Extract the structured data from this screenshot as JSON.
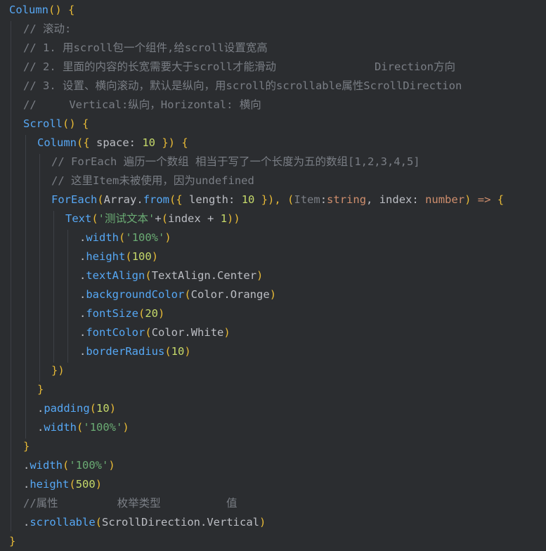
{
  "lines": [
    [
      {
        "t": "Column",
        "c": "fn"
      },
      {
        "t": "() ",
        "c": "brc"
      },
      {
        "t": "{",
        "c": "brc"
      }
    ],
    [
      {
        "t": "// 滚动:",
        "c": "cmt"
      }
    ],
    [
      {
        "t": "// 1. 用scroll包一个组件,给scroll设置宽高",
        "c": "cmt"
      }
    ],
    [
      {
        "t": "// 2. 里面的内容的长宽需要大于scroll才能滑动               Direction方向",
        "c": "cmt"
      }
    ],
    [
      {
        "t": "// 3. 设置、横向滚动，默认是纵向，用scroll的scrollable属性ScrollDirection",
        "c": "cmt"
      }
    ],
    [
      {
        "t": "//     Vertical:纵向，Horizontal: 横向",
        "c": "cmt"
      }
    ],
    [
      {
        "t": "Scroll",
        "c": "fn"
      },
      {
        "t": "() ",
        "c": "brc"
      },
      {
        "t": "{",
        "c": "brc"
      }
    ],
    [
      {
        "t": "Column",
        "c": "fn"
      },
      {
        "t": "({ ",
        "c": "brc"
      },
      {
        "t": "space",
        "c": "txt"
      },
      {
        "t": ": ",
        "c": "txt"
      },
      {
        "t": "10",
        "c": "numy"
      },
      {
        "t": " }) {",
        "c": "brc"
      }
    ],
    [
      {
        "t": "// ForEach 遍历一个数组 相当于写了一个长度为五的数组[1,2,3,4,5]",
        "c": "cmt"
      }
    ],
    [
      {
        "t": "// 这里Item未被使用，因为undefined",
        "c": "cmt"
      }
    ],
    [
      {
        "t": "ForEach",
        "c": "fn"
      },
      {
        "t": "(",
        "c": "brc"
      },
      {
        "t": "Array",
        "c": "txt"
      },
      {
        "t": ".",
        "c": "txt"
      },
      {
        "t": "from",
        "c": "mth"
      },
      {
        "t": "({ ",
        "c": "brc"
      },
      {
        "t": "length",
        "c": "txt"
      },
      {
        "t": ": ",
        "c": "txt"
      },
      {
        "t": "10",
        "c": "numy"
      },
      {
        "t": " }), ",
        "c": "brc"
      },
      {
        "t": "(",
        "c": "brc"
      },
      {
        "t": "Item",
        "c": "prm"
      },
      {
        "t": ":",
        "c": "txt"
      },
      {
        "t": "string",
        "c": "kw"
      },
      {
        "t": ", ",
        "c": "txt"
      },
      {
        "t": "index",
        "c": "txt"
      },
      {
        "t": ": ",
        "c": "txt"
      },
      {
        "t": "number",
        "c": "kw"
      },
      {
        "t": ") ",
        "c": "brc"
      },
      {
        "t": "=> ",
        "c": "kw"
      },
      {
        "t": "{",
        "c": "brc"
      }
    ],
    [
      {
        "t": "Text",
        "c": "fn"
      },
      {
        "t": "(",
        "c": "brc"
      },
      {
        "t": "'测试文本'",
        "c": "str"
      },
      {
        "t": "+",
        "c": "txt"
      },
      {
        "t": "(",
        "c": "brc"
      },
      {
        "t": "index",
        "c": "txt"
      },
      {
        "t": " + ",
        "c": "txt"
      },
      {
        "t": "1",
        "c": "numy"
      },
      {
        "t": "))",
        "c": "brc"
      }
    ],
    [
      {
        "t": ".",
        "c": "txt"
      },
      {
        "t": "width",
        "c": "mth"
      },
      {
        "t": "(",
        "c": "brc"
      },
      {
        "t": "'100%'",
        "c": "str"
      },
      {
        "t": ")",
        "c": "brc"
      }
    ],
    [
      {
        "t": ".",
        "c": "txt"
      },
      {
        "t": "height",
        "c": "mth"
      },
      {
        "t": "(",
        "c": "brc"
      },
      {
        "t": "100",
        "c": "numy"
      },
      {
        "t": ")",
        "c": "brc"
      }
    ],
    [
      {
        "t": ".",
        "c": "txt"
      },
      {
        "t": "textAlign",
        "c": "mth"
      },
      {
        "t": "(",
        "c": "brc"
      },
      {
        "t": "TextAlign",
        "c": "txt"
      },
      {
        "t": ".",
        "c": "txt"
      },
      {
        "t": "Center",
        "c": "txt"
      },
      {
        "t": ")",
        "c": "brc"
      }
    ],
    [
      {
        "t": ".",
        "c": "txt"
      },
      {
        "t": "backgroundColor",
        "c": "mth"
      },
      {
        "t": "(",
        "c": "brc"
      },
      {
        "t": "Color",
        "c": "txt"
      },
      {
        "t": ".",
        "c": "txt"
      },
      {
        "t": "Orange",
        "c": "txt"
      },
      {
        "t": ")",
        "c": "brc"
      }
    ],
    [
      {
        "t": ".",
        "c": "txt"
      },
      {
        "t": "fontSize",
        "c": "mth"
      },
      {
        "t": "(",
        "c": "brc"
      },
      {
        "t": "20",
        "c": "numy"
      },
      {
        "t": ")",
        "c": "brc"
      }
    ],
    [
      {
        "t": ".",
        "c": "txt"
      },
      {
        "t": "fontColor",
        "c": "mth"
      },
      {
        "t": "(",
        "c": "brc"
      },
      {
        "t": "Color",
        "c": "txt"
      },
      {
        "t": ".",
        "c": "txt"
      },
      {
        "t": "White",
        "c": "txt"
      },
      {
        "t": ")",
        "c": "brc"
      }
    ],
    [
      {
        "t": ".",
        "c": "txt"
      },
      {
        "t": "borderRadius",
        "c": "mth"
      },
      {
        "t": "(",
        "c": "brc"
      },
      {
        "t": "10",
        "c": "numy"
      },
      {
        "t": ")",
        "c": "brc"
      }
    ],
    [
      {
        "t": "})",
        "c": "brc"
      }
    ],
    [
      {
        "t": "}",
        "c": "brc"
      }
    ],
    [
      {
        "t": ".",
        "c": "txt"
      },
      {
        "t": "padding",
        "c": "mth"
      },
      {
        "t": "(",
        "c": "brc"
      },
      {
        "t": "10",
        "c": "numy"
      },
      {
        "t": ")",
        "c": "brc"
      }
    ],
    [
      {
        "t": ".",
        "c": "txt"
      },
      {
        "t": "width",
        "c": "mth"
      },
      {
        "t": "(",
        "c": "brc"
      },
      {
        "t": "'100%'",
        "c": "str"
      },
      {
        "t": ")",
        "c": "brc"
      }
    ],
    [
      {
        "t": "}",
        "c": "brc"
      }
    ],
    [
      {
        "t": ".",
        "c": "txt"
      },
      {
        "t": "width",
        "c": "mth"
      },
      {
        "t": "(",
        "c": "brc"
      },
      {
        "t": "'100%'",
        "c": "str"
      },
      {
        "t": ")",
        "c": "brc"
      }
    ],
    [
      {
        "t": ".",
        "c": "txt"
      },
      {
        "t": "height",
        "c": "mth"
      },
      {
        "t": "(",
        "c": "brc"
      },
      {
        "t": "500",
        "c": "numy"
      },
      {
        "t": ")",
        "c": "brc"
      }
    ],
    [
      {
        "t": "//属性         枚举类型          值",
        "c": "cmt"
      }
    ],
    [
      {
        "t": ".",
        "c": "txt"
      },
      {
        "t": "scrollable",
        "c": "mth"
      },
      {
        "t": "(",
        "c": "brc"
      },
      {
        "t": "ScrollDirection",
        "c": "txt"
      },
      {
        "t": ".",
        "c": "txt"
      },
      {
        "t": "Vertical",
        "c": "txt"
      },
      {
        "t": ")",
        "c": "brc"
      }
    ],
    [
      {
        "t": "}",
        "c": "brc"
      }
    ]
  ]
}
